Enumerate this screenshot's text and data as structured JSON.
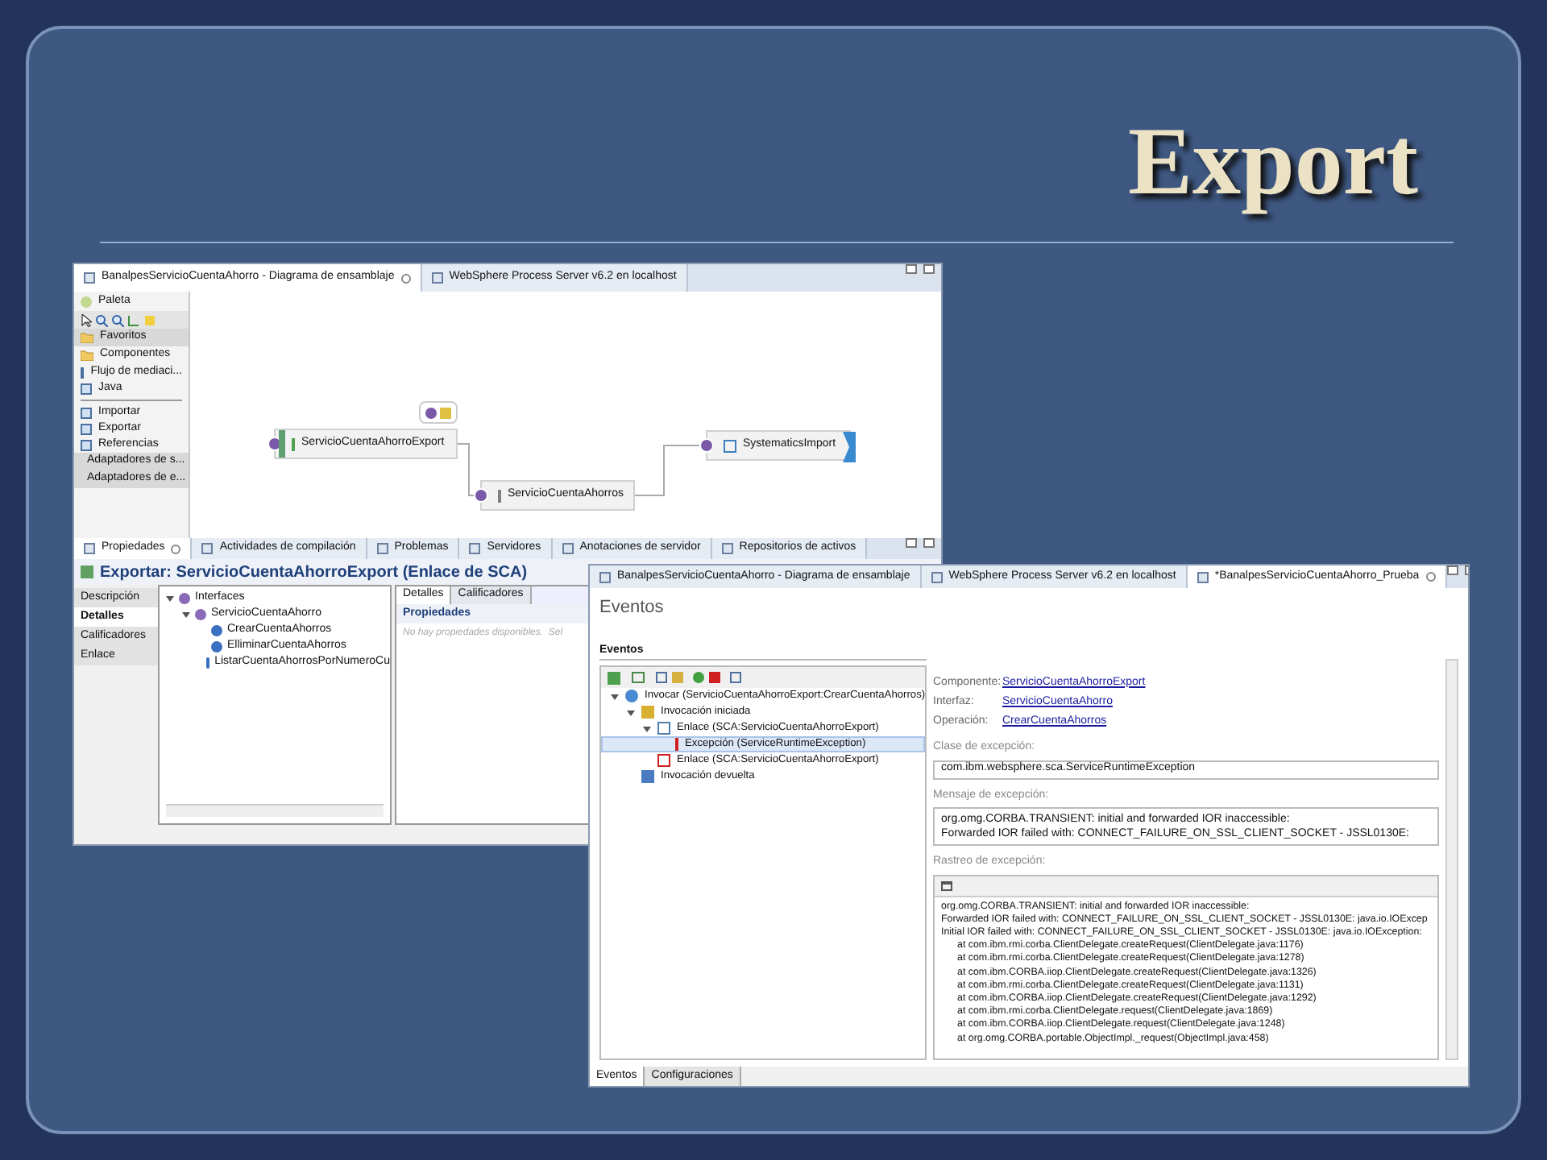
{
  "slide": {
    "title": "Export"
  },
  "window_1": {
    "tabs": [
      {
        "label": "BanalpesServicioCuentaAhorro - Diagrama de ensamblaje",
        "selected": true
      },
      {
        "label": "WebSphere Process Server v6.2 en localhost",
        "selected": false
      }
    ],
    "palette": {
      "title": "Paleta",
      "items": [
        {
          "kind": "drawer",
          "label": "Favoritos",
          "selected": true
        },
        {
          "kind": "drawer",
          "label": "Componentes",
          "selected": false
        },
        {
          "kind": "item",
          "label": "Flujo de mediaci..."
        },
        {
          "kind": "item",
          "label": "Java"
        },
        {
          "kind": "separator"
        },
        {
          "kind": "item",
          "label": "Importar"
        },
        {
          "kind": "item",
          "label": "Exportar"
        },
        {
          "kind": "item",
          "label": "Referencias"
        },
        {
          "kind": "drawer",
          "label": "Adaptadores de s...",
          "selected": true
        },
        {
          "kind": "drawer",
          "label": "Adaptadores de e...",
          "selected": true
        }
      ]
    },
    "nodes": [
      {
        "kind": "export",
        "label": "ServicioCuentaAhorroExport"
      },
      {
        "kind": "component",
        "label": "ServicioCuentaAhorros"
      },
      {
        "kind": "import",
        "label": "SystematicsImport"
      }
    ],
    "bottom_tabs": [
      {
        "label": "Propiedades",
        "selected": true
      },
      {
        "label": "Actividades de compilación",
        "selected": false
      },
      {
        "label": "Problemas",
        "selected": false
      },
      {
        "label": "Servidores",
        "selected": false
      },
      {
        "label": "Anotaciones de servidor",
        "selected": false
      },
      {
        "label": "Repositorios de activos",
        "selected": false
      }
    ],
    "properties": {
      "title": "Exportar: ServicioCuentaAhorroExport (Enlace de SCA)",
      "side_tabs": [
        {
          "label": "Descripción",
          "selected": false
        },
        {
          "label": "Detalles",
          "selected": true
        },
        {
          "label": "Calificadores",
          "selected": false
        },
        {
          "label": "Enlace",
          "selected": false
        }
      ],
      "tree": [
        {
          "label": "Interfaces",
          "expanded": true,
          "children": [
            {
              "label": "ServicioCuentaAhorro",
              "expanded": true,
              "children": [
                {
                  "label": "CrearCuentaAhorros"
                },
                {
                  "label": "ElliminarCuentaAhorros"
                },
                {
                  "label": "ListarCuentaAhorrosPorNumeroCu"
                }
              ]
            }
          ]
        }
      ],
      "detail_tabs": [
        {
          "label": "Detalles",
          "selected": true
        },
        {
          "label": "Calificadores",
          "selected": false
        }
      ],
      "section": "Propiedades",
      "message": "No hay propiedades disponibles.  Sel"
    }
  },
  "window_2": {
    "tabs": [
      {
        "label": "BanalpesServicioCuentaAhorro - Diagrama de ensamblaje",
        "selected": false
      },
      {
        "label": "WebSphere Process Server v6.2 en localhost",
        "selected": false
      },
      {
        "label": "*BanalpesServicioCuentaAhorro_Prueba",
        "selected": true
      }
    ],
    "heading": "Eventos",
    "events": {
      "title": "Eventos",
      "tree": [
        {
          "kind": "invoke",
          "label": "Invocar (ServicioCuentaAhorroExport:CrearCuentaAhorros)",
          "expanded": true,
          "selected": false,
          "children": [
            {
              "kind": "started",
              "label": "Invocación iniciada",
              "expanded": true,
              "selected": false,
              "children": [
                {
                  "kind": "binding",
                  "label": "Enlace (SCA:ServicioCuentaAhorroExport)",
                  "expanded": true,
                  "selected": false,
                  "children": [
                    {
                      "kind": "exception",
                      "label": "Excepción (ServiceRuntimeException)",
                      "selected": true
                    }
                  ]
                },
                {
                  "kind": "binding_error",
                  "label": "Enlace (SCA:ServicioCuentaAhorroExport)",
                  "selected": false
                }
              ]
            },
            {
              "kind": "returned",
              "label": "Invocación devuelta",
              "selected": false
            }
          ]
        }
      ]
    },
    "details": {
      "fields": [
        {
          "label": "Componente:",
          "value": "ServicioCuentaAhorroExport"
        },
        {
          "label": "Interfaz:",
          "value": "ServicioCuentaAhorro"
        },
        {
          "label": "Operación:",
          "value": "CrearCuentaAhorros"
        }
      ],
      "exception_class": {
        "label": "Clase de excepción:",
        "value": "com.ibm.websphere.sca.ServiceRuntimeException"
      },
      "message": {
        "label": "Mensaje de excepción:",
        "lines": [
          "org.omg.CORBA.TRANSIENT: initial and forwarded IOR inaccessible:",
          "Forwarded IOR failed with: CONNECT_FAILURE_ON_SSL_CLIENT_SOCKET - JSSL0130E:"
        ]
      },
      "trace": {
        "label": "Rastreo de excepción:",
        "lines": [
          {
            "kind": "message",
            "text": "org.omg.CORBA.TRANSIENT: initial and forwarded IOR inaccessible:"
          },
          {
            "kind": "message",
            "text": "Forwarded IOR failed with: CONNECT_FAILURE_ON_SSL_CLIENT_SOCKET - JSSL0130E: java.io.IOExcep"
          },
          {
            "kind": "message",
            "text": "Initial IOR failed with: CONNECT_FAILURE_ON_SSL_CLIENT_SOCKET - JSSL0130E: java.io.IOException:"
          },
          {
            "kind": "frame",
            "text": "at com.ibm.rmi.corba.ClientDelegate.createRequest(ClientDelegate.java:1176)"
          },
          {
            "kind": "frame",
            "text": "at com.ibm.rmi.corba.ClientDelegate.createRequest(ClientDelegate.java:1278)"
          },
          {
            "kind": "frame",
            "text": "at com.ibm.CORBA.iiop.ClientDelegate.createRequest(ClientDelegate.java:1326)"
          },
          {
            "kind": "frame",
            "text": "at com.ibm.rmi.corba.ClientDelegate.createRequest(ClientDelegate.java:1131)"
          },
          {
            "kind": "frame",
            "text": "at com.ibm.CORBA.iiop.ClientDelegate.createRequest(ClientDelegate.java:1292)"
          },
          {
            "kind": "frame",
            "text": "at com.ibm.rmi.corba.ClientDelegate.request(ClientDelegate.java:1869)"
          },
          {
            "kind": "frame",
            "text": "at com.ibm.CORBA.iiop.ClientDelegate.request(ClientDelegate.java:1248)"
          },
          {
            "kind": "frame",
            "text": "at org.omg.CORBA.portable.ObjectImpl._request(ObjectImpl.java:458)"
          }
        ]
      }
    },
    "bottom_tabs": [
      {
        "label": "Eventos",
        "selected": true
      },
      {
        "label": "Configuraciones",
        "selected": false
      }
    ]
  }
}
